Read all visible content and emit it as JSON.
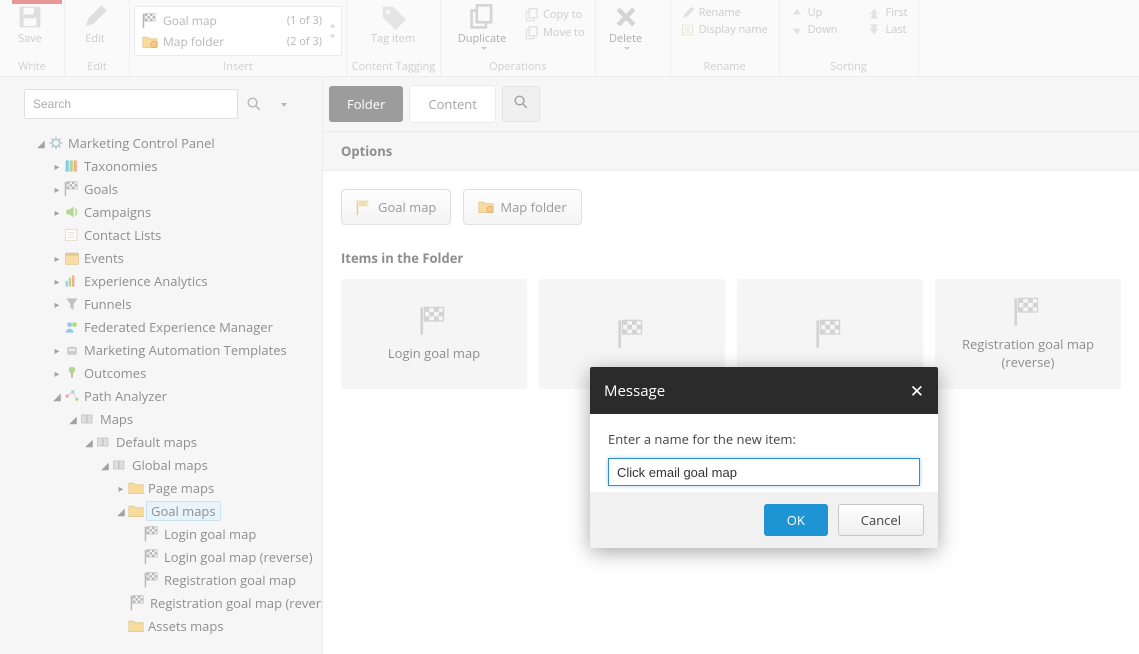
{
  "ribbon": {
    "save": {
      "top": "Save",
      "bottom": "Write"
    },
    "edit": {
      "top": "Edit",
      "bottom": "Edit"
    },
    "insert": {
      "label": "Insert",
      "rows": [
        {
          "label": "Goal map",
          "count": "(1 of 3)"
        },
        {
          "label": "Map folder",
          "count": "(2 of 3)"
        }
      ]
    },
    "tag": {
      "top": "Tag item",
      "group": "Content Tagging"
    },
    "dup": {
      "label": "Duplicate"
    },
    "copy": "Copy to",
    "move": "Move to",
    "opsGroup": "Operations",
    "del": "Delete",
    "rename": "Rename",
    "display": "Display name",
    "renameGroup": "Rename",
    "up": "Up",
    "down": "Down",
    "first": "First",
    "last": "Last",
    "sortGroup": "Sorting"
  },
  "search": {
    "placeholder": "Search"
  },
  "tree": {
    "root": "Marketing Control Panel",
    "taxonomies": "Taxonomies",
    "goals": "Goals",
    "campaigns": "Campaigns",
    "contacts": "Contact Lists",
    "events": "Events",
    "ea": "Experience Analytics",
    "funnels": "Funnels",
    "fem": "Federated Experience Manager",
    "mat": "Marketing Automation Templates",
    "outcomes": "Outcomes",
    "pa": "Path Analyzer",
    "maps": "Maps",
    "defmaps": "Default maps",
    "globalmaps": "Global maps",
    "pagemaps": "Page maps",
    "goalmaps": "Goal maps",
    "g1": "Login goal map",
    "g2": "Login goal map (reverse)",
    "g3": "Registration goal map",
    "g4": "Registration goal map (reverse)",
    "assets": "Assets maps"
  },
  "tabs": {
    "folder": "Folder",
    "content": "Content"
  },
  "options": {
    "heading": "Options",
    "goalmap": "Goal map",
    "mapfolder": "Map folder"
  },
  "items": {
    "heading": "Items in the Folder",
    "c1": "Login goal map",
    "c4": "Registration goal map (reverse)"
  },
  "dialog": {
    "title": "Message",
    "prompt": "Enter a name for the new item:",
    "value": "Click email goal map",
    "ok": "OK",
    "cancel": "Cancel"
  }
}
